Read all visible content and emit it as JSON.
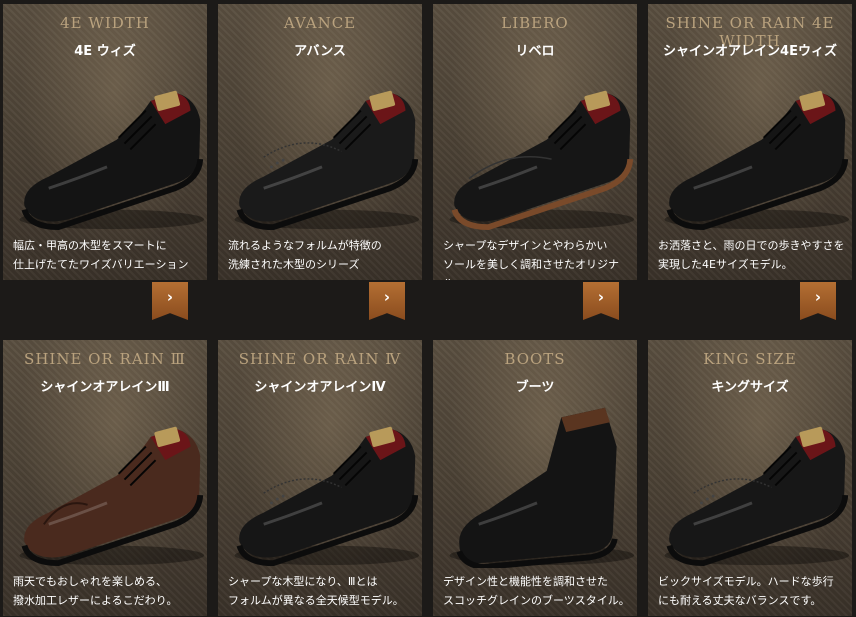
{
  "products": [
    {
      "en": "4E WIDTH",
      "jp": "4E ウィズ",
      "desc": "幅広・甲高の木型をスマートに\n仕上げたてたワイズバリエーション",
      "color": "#141414",
      "variant": "derby"
    },
    {
      "en": "AVANCE",
      "jp": "アバンス",
      "desc": "流れるようなフォルムが特徴の\n洗練された木型のシリーズ",
      "color": "#1a1a1a",
      "variant": "wingtip"
    },
    {
      "en": "LIBERO",
      "jp": "リベロ",
      "desc": "シャープなデザインとやわらかい\nソールを美しく調和させたオリジナル。",
      "color": "#161616",
      "variant": "moc"
    },
    {
      "en": "SHINE OR RAIN 4E WIDTH",
      "jp": "シャインオアレイン4Eウィズ",
      "desc": "お洒落さと、雨の日での歩きやすさを\n実現した4Eサイズモデル。",
      "color": "#151515",
      "variant": "derby"
    },
    {
      "en": "SHINE OR RAIN Ⅲ",
      "jp": "シャインオアレインⅢ",
      "desc": "雨天でもおしゃれを楽しめる、\n撥水加工レザーによるこだわり。",
      "color": "#4a2a1e",
      "variant": "captoe"
    },
    {
      "en": "SHINE OR RAIN Ⅳ",
      "jp": "シャインオアレインⅣ",
      "desc": "シャープな木型になり、Ⅲとは\nフォルムが異なる全天候型モデル。",
      "color": "#161616",
      "variant": "wholecut"
    },
    {
      "en": "BOOTS",
      "jp": "ブーツ",
      "desc": "デザイン性と機能性を調和させた\nスコッチグレインのブーツスタイル。",
      "color": "#141414",
      "variant": "boot"
    },
    {
      "en": "KING SIZE",
      "jp": "キングサイズ",
      "desc": "ビックサイズモデル。ハードな歩行\nにも耐える丈夫なバランスです。",
      "color": "#171717",
      "variant": "wingtip"
    }
  ],
  "more_label": "›"
}
